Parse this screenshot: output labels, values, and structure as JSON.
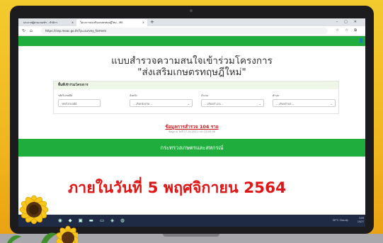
{
  "browser": {
    "tabs": [
      {
        "label": "ประกาศผู้ผ่านเกณฑ์ฯ - สำนักฯ"
      },
      {
        "label": "โครงการส่งเสริมเกษตรทฤษฎีใหม่ - ME"
      }
    ],
    "url": "https://riep.moac.go.th/?p=survey_farmers"
  },
  "page": {
    "title_line1": "แบบสำรวจความสนใจเข้าร่วมโครงการ",
    "title_line2": "\"ส่งเสริมเกษตรทฤษฎีใหม่\"",
    "section_title": "พื้นที่เข้าร่วมโครงการ",
    "fields": [
      {
        "label": "รหัสไปรษณีย์",
        "value": "รหัสไปรษณีย์"
      },
      {
        "label": "จังหวัด",
        "value": "-- เลือกจังหวัด --"
      },
      {
        "label": "อำเภอ",
        "value": "-- เลือกอำเภอ --"
      },
      {
        "label": "ตำบล",
        "value": "-- เลือกตำบล --"
      }
    ],
    "stats_link": "ข้อมูลการสำรวจ 104 ราย",
    "stats_date": "ข้อมูล ณ วันที่ 27-10-2021 เวลา 15:09:38",
    "ministry": "กระทรวงเกษตรและสหกรณ์"
  },
  "taskbar": {
    "weather": "30°C Cloudy",
    "clock_time": "3:09",
    "clock_date": "10/27"
  },
  "banner": {
    "deadline": "ภายในวันที่ 5 พฤศจิกายน 2564"
  },
  "colors": {
    "brand_green": "#1fae3e",
    "deadline_red": "#e01616",
    "background_yellow": "#f0b820"
  }
}
